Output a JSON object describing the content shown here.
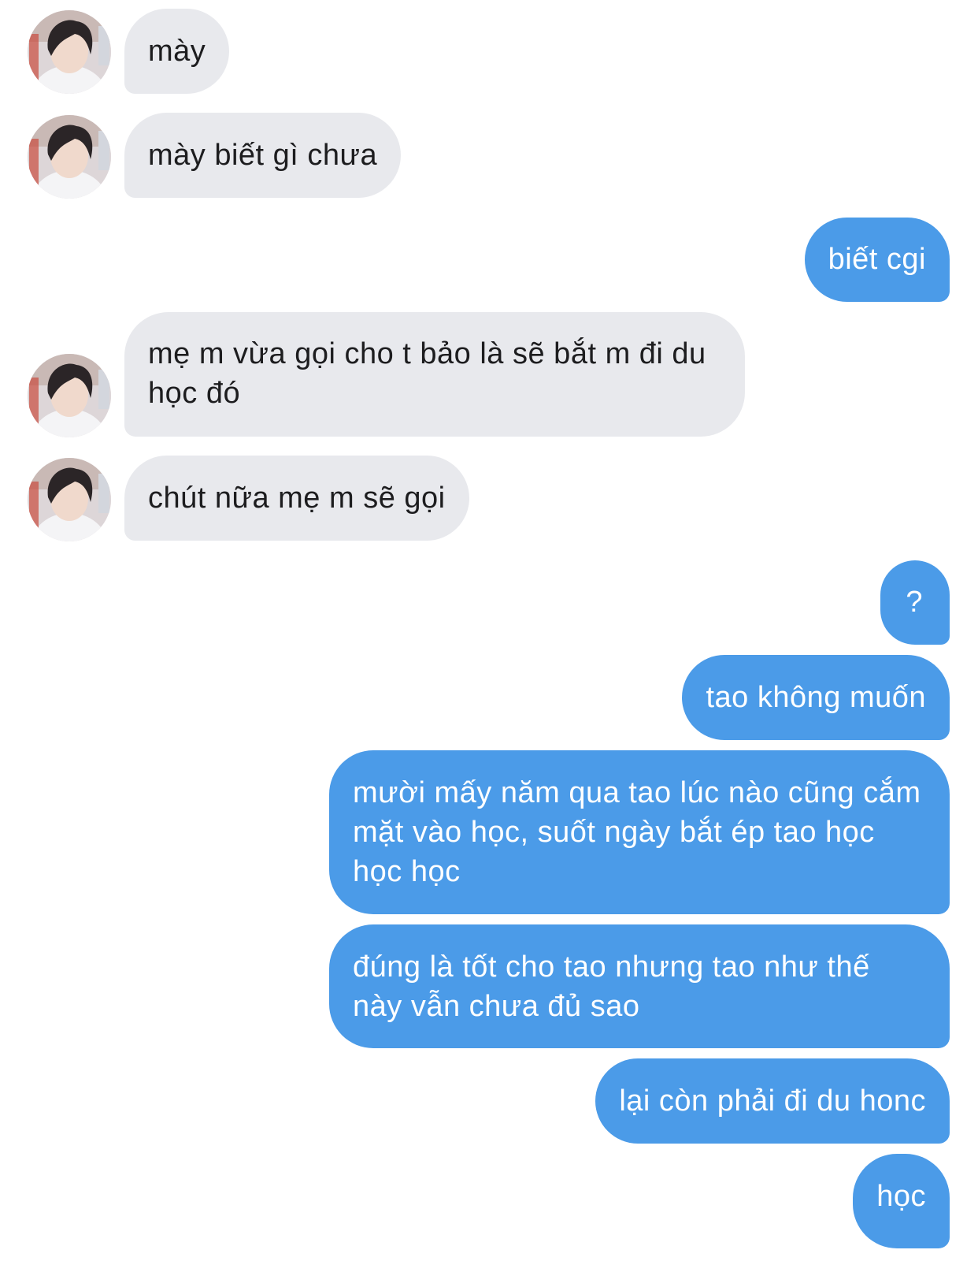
{
  "messages": [
    {
      "sender": "them",
      "text": "mày"
    },
    {
      "sender": "them",
      "text": "mày biết gì chưa"
    },
    {
      "sender": "me",
      "text": "biết cgi"
    },
    {
      "sender": "them",
      "text": "mẹ m vừa gọi cho t bảo là sẽ bắt m đi du học đó"
    },
    {
      "sender": "them",
      "text": "chút nữa mẹ m sẽ gọi"
    },
    {
      "sender": "me",
      "text": "?"
    },
    {
      "sender": "me",
      "text": "tao không muốn"
    },
    {
      "sender": "me",
      "text": "mười mấy năm qua tao lúc nào cũng cắm mặt vào học, suốt ngày bắt ép tao học học học"
    },
    {
      "sender": "me",
      "text": "đúng là tốt cho tao nhưng tao như thế này vẫn chưa đủ sao"
    },
    {
      "sender": "me",
      "text": "lại còn phải đi du honc"
    },
    {
      "sender": "me",
      "text": "học"
    }
  ],
  "colors": {
    "incoming_bubble": "#e8e9ed",
    "incoming_text": "#1d1d1f",
    "outgoing_bubble": "#4b9be8",
    "outgoing_text": "#ffffff"
  },
  "avatar_icon": "contact-avatar-photo"
}
